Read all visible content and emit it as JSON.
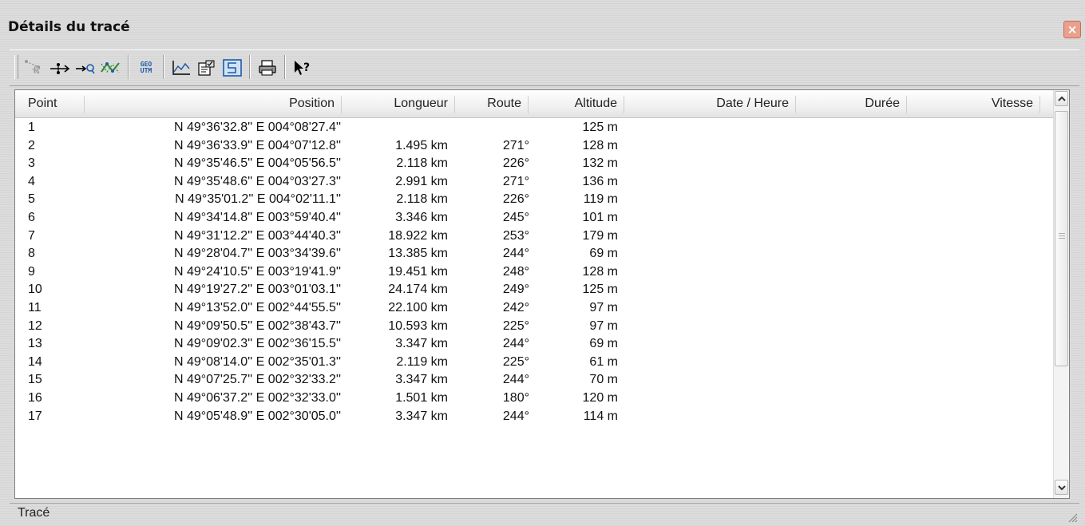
{
  "window": {
    "title": "Détails du tracé",
    "close_label": "×"
  },
  "toolbar": {
    "buttons": [
      {
        "icon": "select-points-icon"
      },
      {
        "icon": "add-waypoint-icon"
      },
      {
        "icon": "goto-icon"
      },
      {
        "icon": "track-simplify-icon"
      },
      {
        "icon": "geo-utm-icon",
        "label_top": "GEO",
        "label_bottom": "UTM"
      },
      {
        "icon": "elevation-profile-icon"
      },
      {
        "icon": "properties-icon"
      },
      {
        "icon": "track-icon"
      },
      {
        "icon": "print-icon"
      },
      {
        "icon": "help-icon"
      }
    ]
  },
  "table": {
    "columns": [
      "Point",
      "Position",
      "Longueur",
      "Route",
      "Altitude",
      "Date / Heure",
      "Durée",
      "Vitesse"
    ],
    "rows": [
      {
        "point": "1",
        "position": "N 49°36'32.8''  E 004°08'27.4''",
        "length": "",
        "route": "",
        "altitude": "125 m"
      },
      {
        "point": "2",
        "position": "N 49°36'33.9''  E 004°07'12.8''",
        "length": "1.495 km",
        "route": "271°",
        "altitude": "128 m"
      },
      {
        "point": "3",
        "position": "N 49°35'46.5''  E 004°05'56.5''",
        "length": "2.118 km",
        "route": "226°",
        "altitude": "132 m"
      },
      {
        "point": "4",
        "position": "N 49°35'48.6''  E 004°03'27.3''",
        "length": "2.991 km",
        "route": "271°",
        "altitude": "136 m"
      },
      {
        "point": "5",
        "position": "N 49°35'01.2''  E 004°02'11.1''",
        "length": "2.118 km",
        "route": "226°",
        "altitude": "119 m"
      },
      {
        "point": "6",
        "position": "N 49°34'14.8''  E 003°59'40.4''",
        "length": "3.346 km",
        "route": "245°",
        "altitude": "101 m"
      },
      {
        "point": "7",
        "position": "N 49°31'12.2''  E 003°44'40.3''",
        "length": "18.922 km",
        "route": "253°",
        "altitude": "179 m"
      },
      {
        "point": "8",
        "position": "N 49°28'04.7''  E 003°34'39.6''",
        "length": "13.385 km",
        "route": "244°",
        "altitude": "69 m"
      },
      {
        "point": "9",
        "position": "N 49°24'10.5''  E 003°19'41.9''",
        "length": "19.451 km",
        "route": "248°",
        "altitude": "128 m"
      },
      {
        "point": "10",
        "position": "N 49°19'27.2''  E 003°01'03.1''",
        "length": "24.174 km",
        "route": "249°",
        "altitude": "125 m"
      },
      {
        "point": "11",
        "position": "N 49°13'52.0''  E 002°44'55.5''",
        "length": "22.100 km",
        "route": "242°",
        "altitude": "97 m"
      },
      {
        "point": "12",
        "position": "N 49°09'50.5''  E 002°38'43.7''",
        "length": "10.593 km",
        "route": "225°",
        "altitude": "97 m"
      },
      {
        "point": "13",
        "position": "N 49°09'02.3''  E 002°36'15.5''",
        "length": "3.347 km",
        "route": "244°",
        "altitude": "69 m"
      },
      {
        "point": "14",
        "position": "N 49°08'14.0''  E 002°35'01.3''",
        "length": "2.119 km",
        "route": "225°",
        "altitude": "61 m"
      },
      {
        "point": "15",
        "position": "N 49°07'25.7''  E 002°32'33.2''",
        "length": "3.347 km",
        "route": "244°",
        "altitude": "70 m"
      },
      {
        "point": "16",
        "position": "N 49°06'37.2''  E 002°32'33.0''",
        "length": "1.501 km",
        "route": "180°",
        "altitude": "120 m"
      },
      {
        "point": "17",
        "position": "N 49°05'48.9''  E 002°30'05.0''",
        "length": "3.347 km",
        "route": "244°",
        "altitude": "114 m"
      }
    ]
  },
  "statusbar": {
    "text": "Tracé"
  },
  "colors": {
    "accent_blue": "#1e5aa8",
    "icon_green": "#2a8a2a"
  }
}
